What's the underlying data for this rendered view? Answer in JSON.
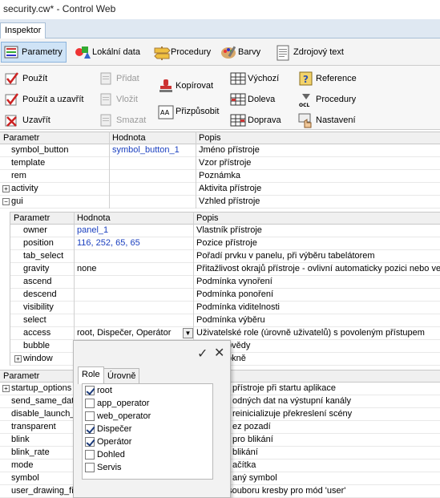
{
  "window": {
    "title": "security.cw* - Control Web"
  },
  "panel_tab": "Inspektor",
  "ribbon_tabs": [
    {
      "label": "Parametry",
      "icon": "xyz-params-icon"
    },
    {
      "label": "Lokální data",
      "icon": "shapes-data-icon"
    },
    {
      "label": "Procedury",
      "icon": "signpost-icon"
    },
    {
      "label": "Barvy",
      "icon": "palette-icon"
    },
    {
      "label": "Zdrojový text",
      "icon": "document-icon"
    }
  ],
  "toolbar": {
    "pouzit": "Použít",
    "pouzit_zavrit": "Použít a uzavřít",
    "uzavrit": "Uzavřít",
    "pridat": "Přidat",
    "vlozit": "Vložit",
    "smazat": "Smazat",
    "kopirovat": "Kopírovat",
    "prizpusobit": "Přizpůsobit",
    "vychozi": "Výchozí",
    "doleva": "Doleva",
    "doprava": "Doprava",
    "reference": "Reference",
    "procedury": "Procedury",
    "nastaveni": "Nastavení",
    "ocl": "OCL"
  },
  "grid": {
    "headers": [
      "Parametr",
      "Hodnota",
      "Popis"
    ],
    "rows": [
      {
        "param": "symbol_button",
        "value": "symbol_button_1",
        "desc": "Jméno přístroje"
      },
      {
        "param": "template",
        "value": "",
        "desc": "Vzor přístroje"
      },
      {
        "param": "rem",
        "value": "",
        "desc": "Poznámka"
      },
      {
        "param": "activity",
        "value": "",
        "desc": "Aktivita přístroje",
        "expander": "+"
      },
      {
        "param": "gui",
        "value": "",
        "desc": "Vzhled přístroje",
        "expander": "−"
      }
    ]
  },
  "subgrid": {
    "headers": [
      "Parametr",
      "Hodnota",
      "Popis"
    ],
    "rows": [
      {
        "param": "owner",
        "value": "panel_1",
        "desc": "Vlastník přístroje"
      },
      {
        "param": "position",
        "value": "116, 252, 65, 65",
        "desc": "Pozice přístroje"
      },
      {
        "param": "tab_select",
        "value": "",
        "desc": "Pořadí prvku v panelu, při výběru tabelátorem"
      },
      {
        "param": "gravity",
        "value": "none",
        "desc": "Přitažlivost okrajů přístroje - ovlivní automaticky pozici nebo vel"
      },
      {
        "param": "ascend",
        "value": "",
        "desc": "Podmínka vynoření"
      },
      {
        "param": "descend",
        "value": "",
        "desc": "Podmínka ponoření"
      },
      {
        "param": "visibility",
        "value": "",
        "desc": "Podmínka viditelnosti"
      },
      {
        "param": "select",
        "value": "",
        "desc": "Podmínka výběru"
      },
      {
        "param": "access",
        "value": "root, Dispečer, Operátor",
        "desc": "Uživatelské role (úrovně uživatelů) s povoleným přístupem"
      },
      {
        "param": "bubble",
        "value": "",
        "desc": "ovědy"
      },
      {
        "param": "window",
        "value": "",
        "desc": "okně",
        "expander": "+"
      }
    ]
  },
  "lowergrid": {
    "header": "Parametr",
    "rows": [
      {
        "param": "startup_options",
        "desc": "přístroje při startu aplikace",
        "expander": "+"
      },
      {
        "param": "send_same_dat",
        "desc": "odných dat na výstupní kanály"
      },
      {
        "param": "disable_launch_",
        "desc": "reinicializuje překreslení scény"
      },
      {
        "param": "transparent",
        "desc": "ez pozadí"
      },
      {
        "param": "blink",
        "desc": "pro blikání",
        "desc_blue_prefix": ""
      },
      {
        "param": "blink_rate",
        "desc": "blikání"
      },
      {
        "param": "mode",
        "desc": "ačítka"
      },
      {
        "param": "symbol",
        "desc": "aný symbol"
      },
      {
        "param": "user_drawing_file",
        "desc": "Jméno souboru kresby pro mód 'user'"
      }
    ]
  },
  "popup": {
    "tabs": [
      "Role",
      "Úrovně"
    ],
    "items": [
      {
        "label": "root",
        "checked": true
      },
      {
        "label": "app_operator",
        "checked": false
      },
      {
        "label": "web_operator",
        "checked": false
      },
      {
        "label": "Dispečer",
        "checked": true
      },
      {
        "label": "Operátor",
        "checked": true
      },
      {
        "label": "Dohled",
        "checked": false
      },
      {
        "label": "Servis",
        "checked": false
      }
    ]
  }
}
